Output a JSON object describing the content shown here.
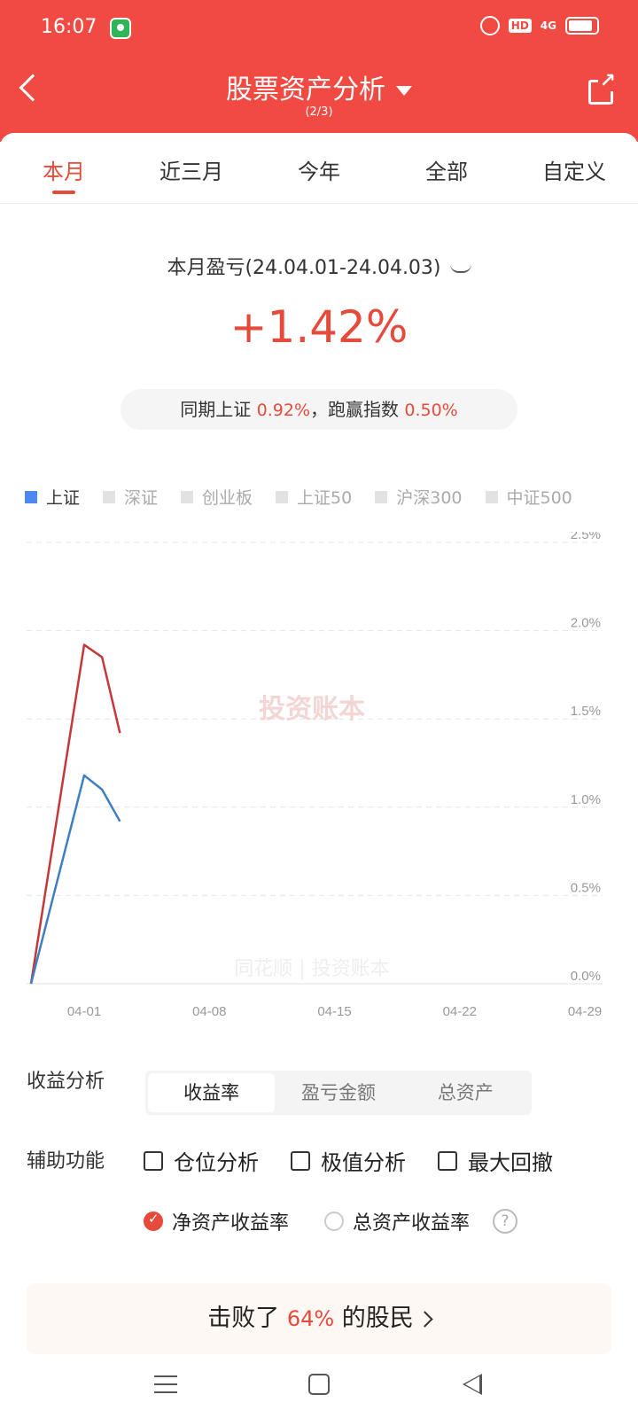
{
  "status_bar": {
    "time": "16:07",
    "network": "4G"
  },
  "header": {
    "title": "股票资产分析",
    "subtitle": "(2/3)"
  },
  "tabs": [
    {
      "label": "本月",
      "active": true
    },
    {
      "label": "近三月",
      "active": false
    },
    {
      "label": "今年",
      "active": false
    },
    {
      "label": "全部",
      "active": false
    },
    {
      "label": "自定义",
      "active": false
    }
  ],
  "summary": {
    "period_label": "本月盈亏(24.04.01-24.04.03)",
    "return_pct": "+1.42%",
    "compare_prefix": "同期上证",
    "compare_index_value": "0.92%",
    "compare_mid": "，跑赢指数",
    "compare_beat_value": "0.50%"
  },
  "legend": [
    {
      "label": "上证",
      "active": true
    },
    {
      "label": "深证",
      "active": false
    },
    {
      "label": "创业板",
      "active": false
    },
    {
      "label": "上证50",
      "active": false
    },
    {
      "label": "沪深300",
      "active": false
    },
    {
      "label": "中证500",
      "active": false
    }
  ],
  "chart_data": {
    "type": "line",
    "x_tick_labels": [
      "04-01",
      "04-08",
      "04-15",
      "04-22",
      "04-29"
    ],
    "y_tick_labels": [
      "0.0%",
      "0.5%",
      "1.0%",
      "1.5%",
      "2.0%",
      "2.5%"
    ],
    "ylim": [
      0,
      2.5
    ],
    "x": [
      "03-28",
      "04-01",
      "04-02",
      "04-03"
    ],
    "series": [
      {
        "color": "#c4373a",
        "values": [
          0,
          1.92,
          1.85,
          1.42
        ]
      },
      {
        "color": "#3f7ec4",
        "values": [
          0,
          1.18,
          1.1,
          0.92
        ]
      }
    ],
    "grid": true,
    "watermark_text": "投资账本",
    "watermark_footer": "同花顺 | 投资账本"
  },
  "analysis": {
    "label": "收益分析",
    "options": [
      {
        "label": "收益率",
        "active": true
      },
      {
        "label": "盈亏金额",
        "active": false
      },
      {
        "label": "总资产",
        "active": false
      }
    ]
  },
  "aux": {
    "label": "辅助功能",
    "checks": [
      "仓位分析",
      "极值分析",
      "最大回撤"
    ]
  },
  "rate_type": {
    "options": [
      {
        "label": "净资产收益率",
        "selected": true
      },
      {
        "label": "总资产收益率",
        "selected": false
      }
    ],
    "help": "?"
  },
  "beat": {
    "prefix": "击败了",
    "value": "64%",
    "suffix": "的股民"
  },
  "colors": {
    "brand": "#f04a43",
    "accent": "#e64a3b",
    "index_line": "#3f7ec4",
    "return_line": "#c4373a"
  }
}
